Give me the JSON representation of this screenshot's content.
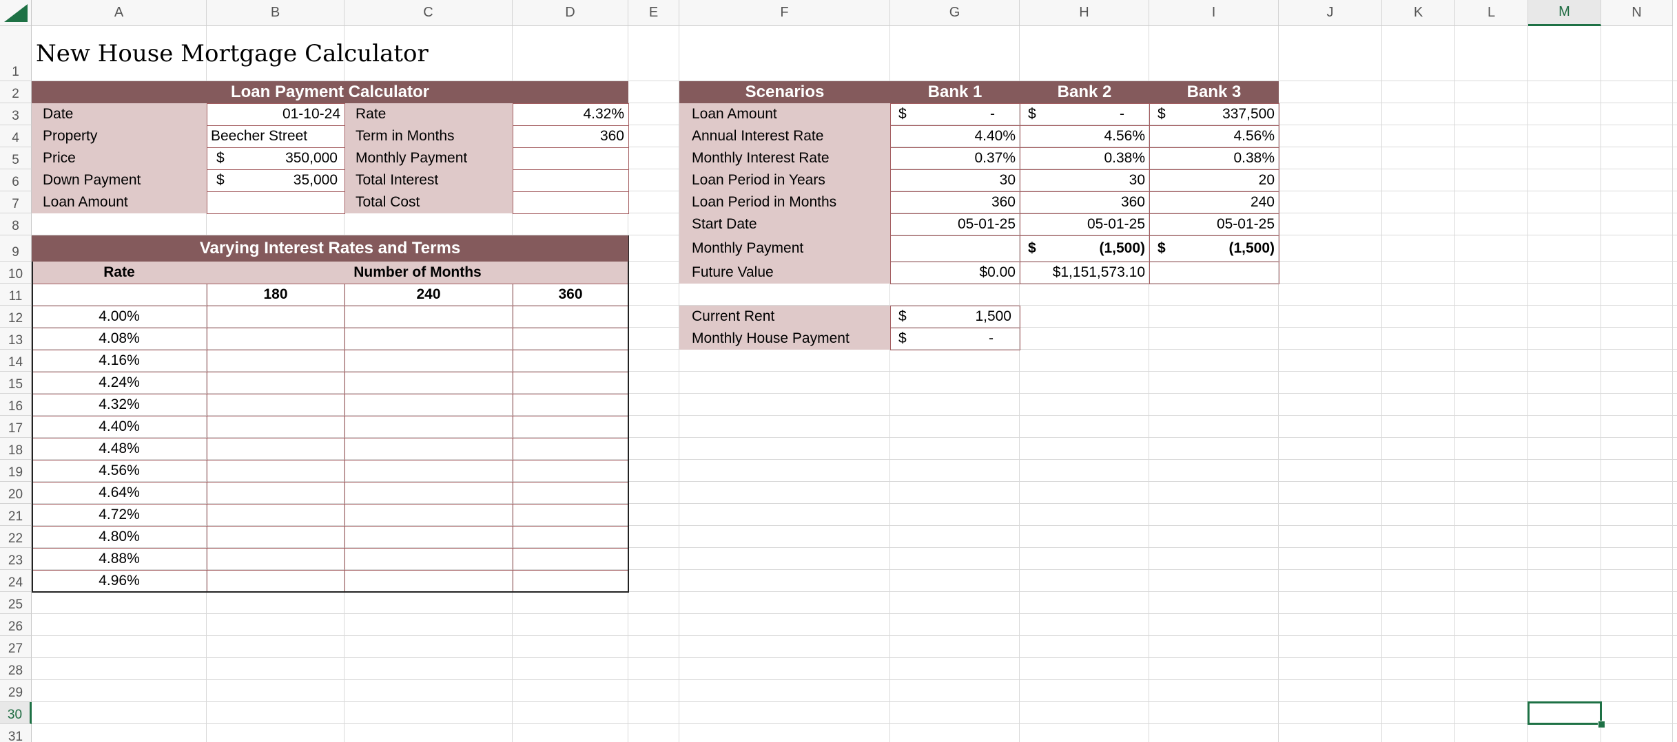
{
  "sheet": {
    "columns": [
      "A",
      "B",
      "C",
      "D",
      "E",
      "F",
      "G",
      "H",
      "I",
      "J",
      "K",
      "L",
      "M",
      "N"
    ],
    "rows": [
      "1",
      "2",
      "3",
      "4",
      "5",
      "6",
      "7",
      "8",
      "9",
      "10",
      "11",
      "12",
      "13",
      "14",
      "15",
      "16",
      "17",
      "18",
      "19",
      "20",
      "21",
      "22",
      "23",
      "24",
      "25",
      "26",
      "27",
      "28",
      "29",
      "30",
      "31"
    ],
    "selected_column": "M",
    "selected_row": "30"
  },
  "title": "New House Mortgage Calculator",
  "loan_calc": {
    "header": "Loan Payment Calculator",
    "date_label": "Date",
    "date_value": "01-10-24",
    "property_label": "Property",
    "property_value": "Beecher Street",
    "price_label": "Price",
    "price_symbol": "$",
    "price_value": "350,000",
    "down_label": "Down Payment",
    "down_symbol": "$",
    "down_value": "35,000",
    "loan_label": "Loan Amount",
    "rate_label": "Rate",
    "rate_value": "4.32%",
    "term_label": "Term in Months",
    "term_value": "360",
    "monthly_label": "Monthly Payment",
    "interest_label": "Total Interest",
    "cost_label": "Total Cost"
  },
  "varying": {
    "header": "Varying Interest Rates and Terms",
    "rate_label": "Rate",
    "months_label": "Number of Months",
    "terms": [
      "180",
      "240",
      "360"
    ],
    "rates": [
      "4.00%",
      "4.08%",
      "4.16%",
      "4.24%",
      "4.32%",
      "4.40%",
      "4.48%",
      "4.56%",
      "4.64%",
      "4.72%",
      "4.80%",
      "4.88%",
      "4.96%"
    ]
  },
  "scenarios": {
    "header": "Scenarios",
    "banks": [
      "Bank 1",
      "Bank 2",
      "Bank 3"
    ],
    "labels": {
      "loan_amount": "Loan Amount",
      "annual_rate": "Annual Interest Rate",
      "monthly_rate": "Monthly Interest Rate",
      "years": "Loan Period in Years",
      "months": "Loan Period in Months",
      "start": "Start Date",
      "payment": "Monthly Payment",
      "future": "Future Value"
    },
    "dollar": "$",
    "loan_amount": [
      "-",
      "-",
      "337,500"
    ],
    "annual_rate": [
      "4.40%",
      "4.56%",
      "4.56%"
    ],
    "monthly_rate": [
      "0.37%",
      "0.38%",
      "0.38%"
    ],
    "years": [
      "30",
      "30",
      "20"
    ],
    "months": [
      "360",
      "360",
      "240"
    ],
    "start": [
      "05-01-25",
      "05-01-25",
      "05-01-25"
    ],
    "payment": [
      "",
      "(1,500)",
      "(1,500)"
    ],
    "future": [
      "$0.00",
      "$1,151,573.10",
      ""
    ]
  },
  "rent": {
    "current_label": "Current Rent",
    "current_symbol": "$",
    "current_value": "1,500",
    "house_label": "Monthly House Payment",
    "house_symbol": "$",
    "house_value": "-"
  },
  "colors": {
    "header": "#845a5c",
    "label_fill": "#dfc9c9",
    "border": "#a35c5f",
    "selection": "#1e7145"
  }
}
